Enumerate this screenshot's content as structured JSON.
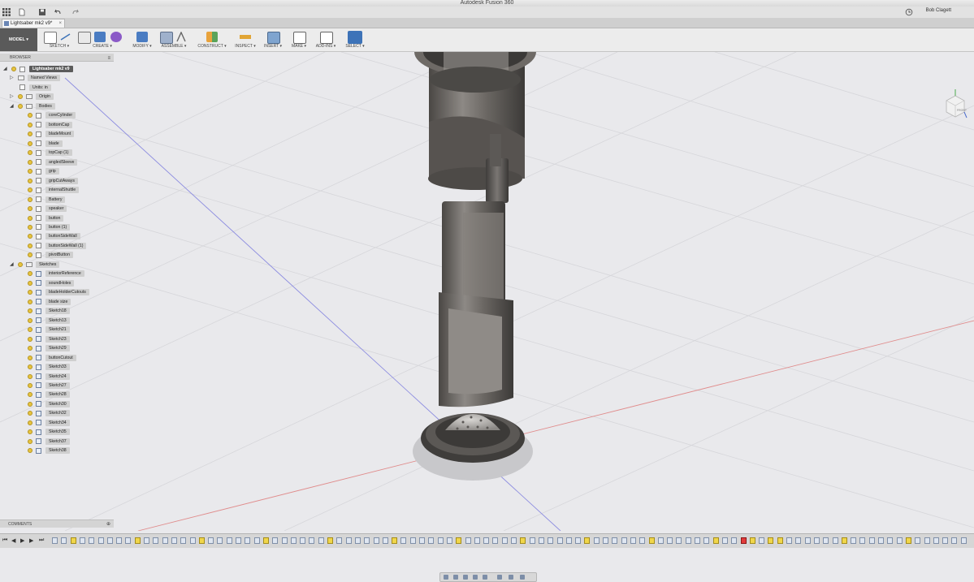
{
  "app": {
    "title": "Autodesk Fusion 360",
    "user": "Bob Clagett"
  },
  "document_tab": {
    "label": "Lightsaber mk2 v9*"
  },
  "toolbar": {
    "workspace": "MODEL",
    "groups": [
      {
        "label": "SKETCH ▾"
      },
      {
        "label": "CREATE ▾"
      },
      {
        "label": "MODIFY ▾"
      },
      {
        "label": "ASSEMBLE ▾"
      },
      {
        "label": "CONSTRUCT ▾"
      },
      {
        "label": "INSPECT ▾"
      },
      {
        "label": "INSERT ▾"
      },
      {
        "label": "MAKE ▾"
      },
      {
        "label": "ADD-INS ▾"
      },
      {
        "label": "SELECT ▾"
      }
    ]
  },
  "browser": {
    "title": "BROWSER",
    "root": "Lightsaber mk2 v9",
    "named_views": "Named Views",
    "units": "Units: in",
    "origin": "Origin",
    "bodies_folder": "Bodies",
    "bodies": [
      "coreCylinder",
      "bottomCap",
      "bladeMount",
      "blade",
      "topCap (1)",
      "angledSleeve",
      "grip",
      "gripCutAways",
      "internalShuttle",
      "Battery",
      "speaker",
      "button",
      "button (1)",
      "buttonSideWall",
      "buttonSideWall (1)",
      "pivotButton"
    ],
    "sketches_folder": "Sketches",
    "sketches": [
      "interiorReference",
      "soundHoles",
      "bladeHolderCutouts",
      "blade size",
      "Sketch18",
      "Sketch13",
      "Sketch21",
      "Sketch23",
      "Sketch29",
      "buttonCutout",
      "Sketch33",
      "Sketch24",
      "Sketch27",
      "Sketch28",
      "Sketch30",
      "Sketch32",
      "Sketch34",
      "Sketch35",
      "Sketch37",
      "Sketch38"
    ]
  },
  "comments": {
    "title": "COMMENTS"
  },
  "viewcube": {
    "face": "FRONT"
  },
  "colors": {
    "accent": "#3d73b8",
    "toolbar_bg": "#ececec",
    "workspace_btn": "#5a5a5a"
  }
}
